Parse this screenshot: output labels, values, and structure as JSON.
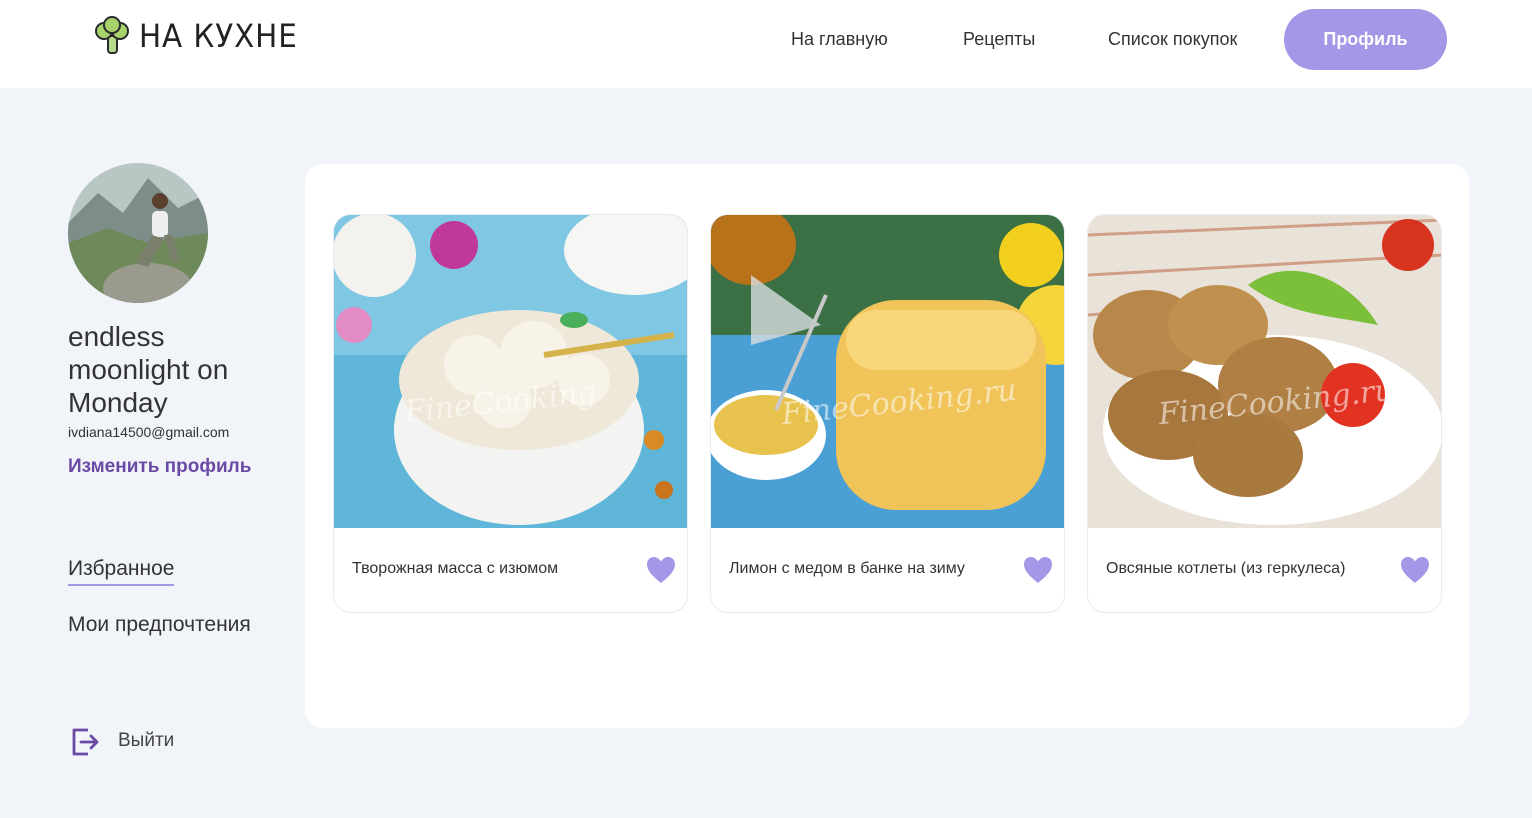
{
  "header": {
    "logo_text": "НА КУХНЕ",
    "nav": [
      "На главную",
      "Рецепты",
      "Список покупок"
    ],
    "profile_button": "Профиль"
  },
  "user": {
    "name": "endless moonlight on Monday",
    "email": "ivdiana14500@gmail.com",
    "edit_link": "Изменить профиль"
  },
  "sidebar": {
    "favorites": "Избранное",
    "preferences": "Мои предпочтения",
    "logout": "Выйти"
  },
  "cards": [
    {
      "title": "Творожная масса с изюмом",
      "liked": true
    },
    {
      "title": "Лимон с медом в банке на зиму",
      "liked": true
    },
    {
      "title": "Овсяные котлеты (из геркулеса)",
      "liked": true
    }
  ],
  "colors": {
    "accent": "#a597e8",
    "link": "#6a4aa5",
    "background": "#f1f4f8"
  }
}
